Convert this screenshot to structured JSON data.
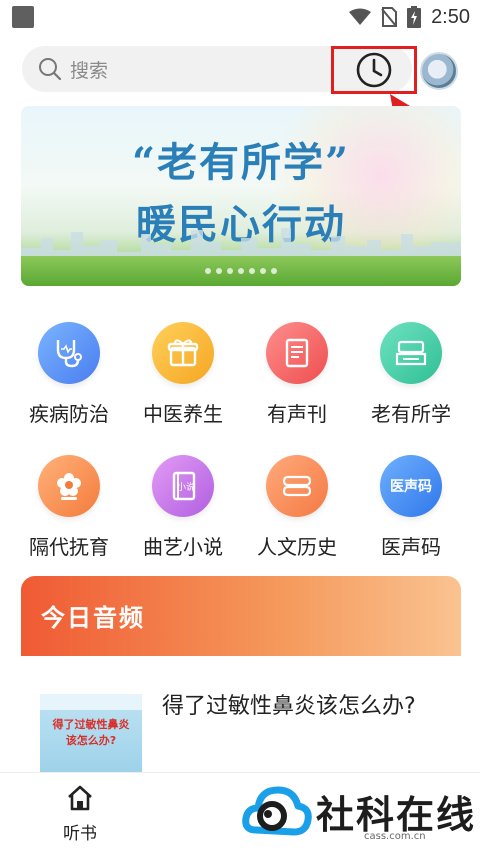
{
  "status_bar": {
    "time": "2:50"
  },
  "search": {
    "placeholder": "搜索"
  },
  "banner": {
    "title_line1": "“老有所学”",
    "title_line2": "暖民心行动",
    "dots": 7
  },
  "categories": [
    {
      "label": "疾病防治",
      "icon": "stethoscope-icon",
      "color_from": "#7ab4ff",
      "color_to": "#4a7df0"
    },
    {
      "label": "中医养生",
      "icon": "gift-box-icon",
      "color_from": "#ffd05a",
      "color_to": "#f5a623"
    },
    {
      "label": "有声刊",
      "icon": "magazine-icon",
      "color_from": "#ff8e8e",
      "color_to": "#ee4e4e"
    },
    {
      "label": "老有所学",
      "icon": "glasses-book-icon",
      "color_from": "#6fe2c0",
      "color_to": "#2fbf96"
    },
    {
      "label": "隔代抚育",
      "icon": "flower-icon",
      "color_from": "#ffb27a",
      "color_to": "#f47b3c"
    },
    {
      "label": "曲艺小说",
      "icon": "novel-book-icon",
      "color_from": "#e39bf5",
      "color_to": "#b05fe0"
    },
    {
      "label": "人文历史",
      "icon": "scroll-icon",
      "color_from": "#ffaa7a",
      "color_to": "#f47a45"
    },
    {
      "label": "医声码",
      "icon": "medical-code-icon",
      "color_from": "#6fb0ff",
      "color_to": "#2f77ea"
    }
  ],
  "today_audio": {
    "title": "今日音频"
  },
  "article": {
    "title": "得了过敏性鼻炎该怎么办?",
    "thumb_line1": "得了过敏性鼻炎",
    "thumb_line2": "该怎么办?"
  },
  "bottom_nav": {
    "listen_label": "听书"
  },
  "watermark": {
    "brand": "社科在线",
    "url": "cass.com.cn"
  },
  "colors": {
    "accent_red": "#e02020",
    "banner_text": "#2a7fb8",
    "today_from": "#f05a34",
    "today_to": "#fac391"
  }
}
